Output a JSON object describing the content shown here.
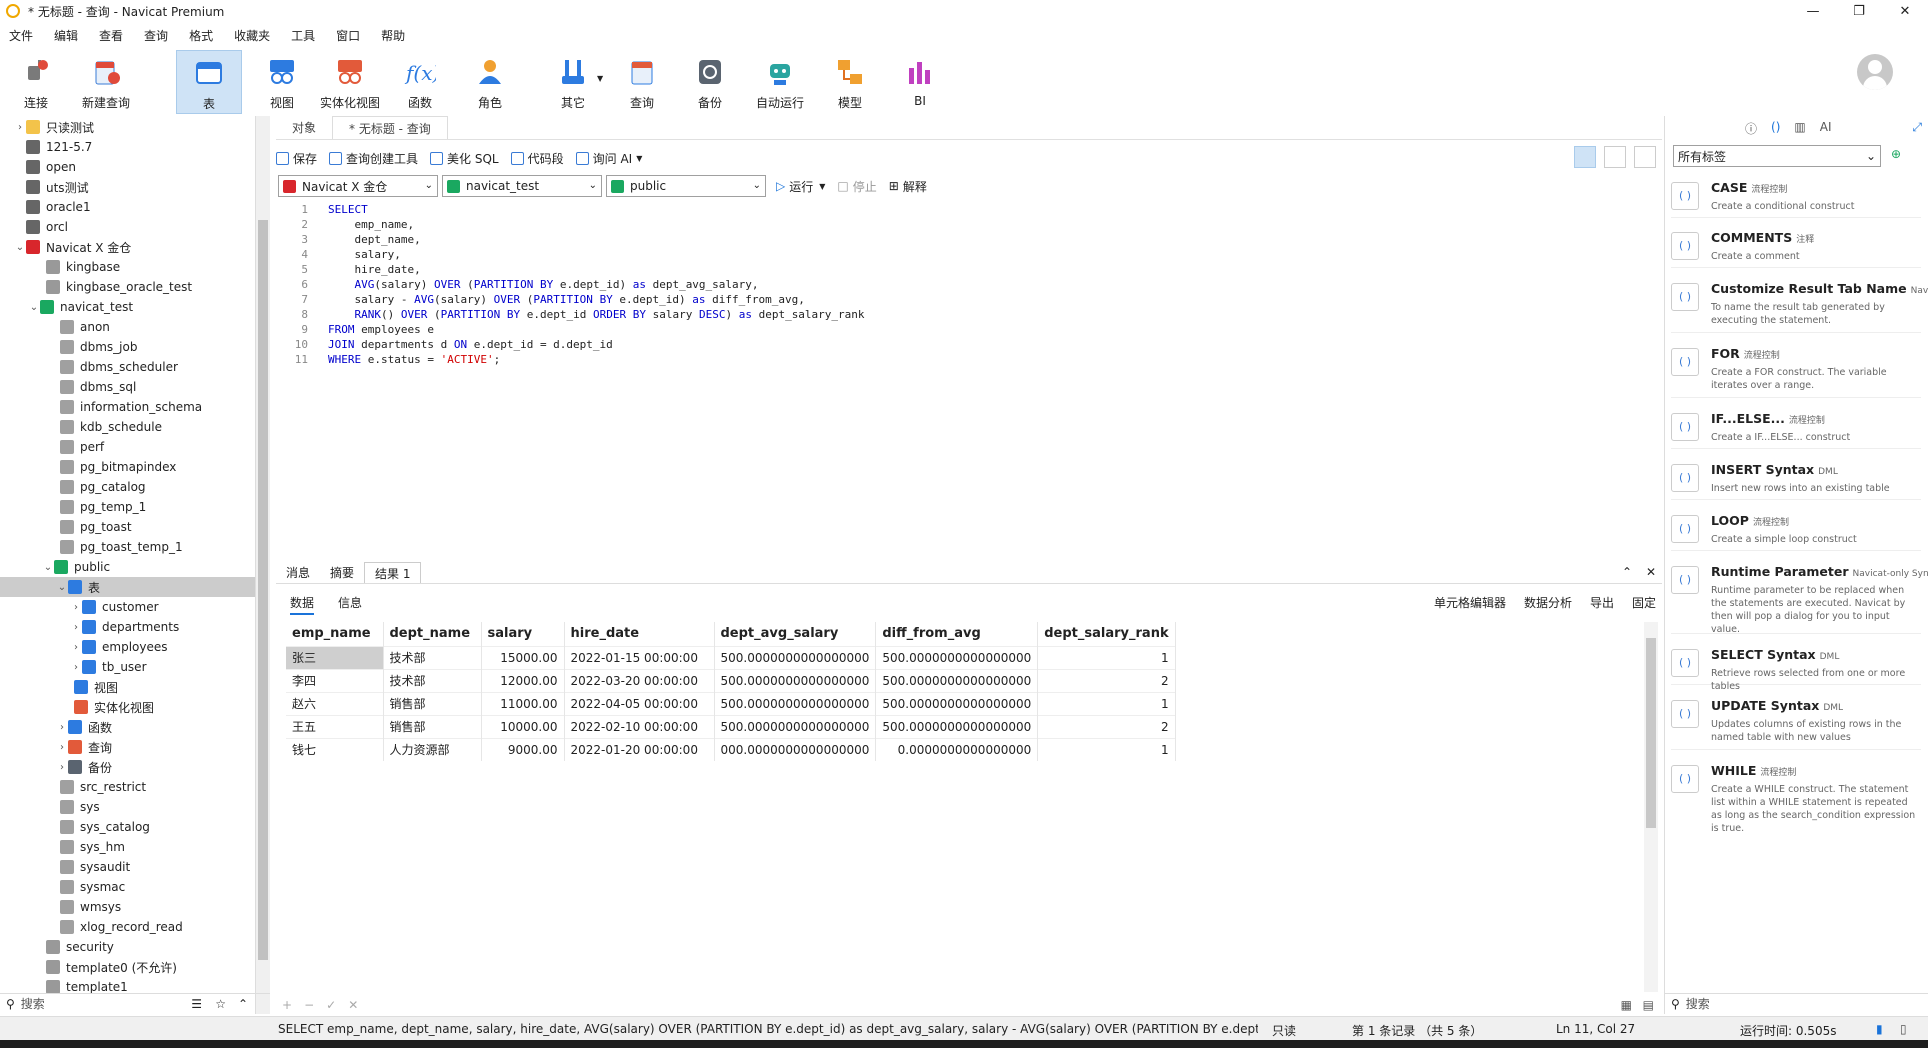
{
  "window": {
    "title": "* 无标题 - 查询 - Navicat Premium"
  },
  "menu": [
    "文件",
    "编辑",
    "查看",
    "查询",
    "格式",
    "收藏夹",
    "工具",
    "窗口",
    "帮助"
  ],
  "toolbar": [
    "连接",
    "新建查询",
    "表",
    "视图",
    "实体化视图",
    "函数",
    "角色",
    "其它",
    "查询",
    "备份",
    "自动运行",
    "模型",
    "BI"
  ],
  "tree": [
    "只读测试",
    "121-5.7",
    "open",
    "uts测试",
    "oracle1",
    "orcl",
    "Navicat X 金仓",
    "kingbase",
    "kingbase_oracle_test",
    "navicat_test",
    "anon",
    "dbms_job",
    "dbms_scheduler",
    "dbms_sql",
    "information_schema",
    "kdb_schedule",
    "perf",
    "pg_bitmapindex",
    "pg_catalog",
    "pg_temp_1",
    "pg_toast",
    "pg_toast_temp_1",
    "public",
    "表",
    "customer",
    "departments",
    "employees",
    "tb_user",
    "视图",
    "实体化视图",
    "函数",
    "查询",
    "备份",
    "src_restrict",
    "sys",
    "sys_catalog",
    "sys_hm",
    "sysaudit",
    "sysmac",
    "wmsys",
    "xlog_record_read",
    "security",
    "template0 (不允许)",
    "template1"
  ],
  "left_search": "搜索",
  "tabs": {
    "objects": "对象",
    "query": "* 无标题 - 查询"
  },
  "query_toolbar": {
    "save": "保存",
    "builder": "查询创建工具",
    "beautify": "美化 SQL",
    "snippet": "代码段",
    "ai": "询问 AI"
  },
  "selectors": {
    "connection": "Navicat X 金仓",
    "database": "navicat_test",
    "schema": "public",
    "run": "运行",
    "stop": "停止",
    "explain": "解释"
  },
  "code": [
    "SELECT",
    "    emp_name,",
    "    dept_name,",
    "    salary,",
    "    hire_date,",
    "    AVG(salary) OVER (PARTITION BY e.dept_id) as dept_avg_salary,",
    "    salary - AVG(salary) OVER (PARTITION BY e.dept_id) as diff_from_avg,",
    "    RANK() OVER (PARTITION BY e.dept_id ORDER BY salary DESC) as dept_salary_rank",
    "FROM employees e",
    "JOIN departments d ON e.dept_id = d.dept_id",
    "WHERE e.status = 'ACTIVE';"
  ],
  "result_tabs": [
    "消息",
    "摘要",
    "结果 1"
  ],
  "sub_tabs": [
    "数据",
    "信息"
  ],
  "result_actions": [
    "单元格编辑器",
    "数据分析",
    "导出",
    "固定"
  ],
  "columns": [
    "emp_name",
    "dept_name",
    "salary",
    "hire_date",
    "dept_avg_salary",
    "diff_from_avg",
    "dept_salary_rank"
  ],
  "rows": [
    [
      "张三",
      "技术部",
      "15000.00",
      "2022-01-15 00:00:00",
      "500.0000000000000000",
      "500.0000000000000000",
      "1"
    ],
    [
      "李四",
      "技术部",
      "12000.00",
      "2022-03-20 00:00:00",
      "500.0000000000000000",
      "500.0000000000000000",
      "2"
    ],
    [
      "赵六",
      "销售部",
      "11000.00",
      "2022-04-05 00:00:00",
      "500.0000000000000000",
      "500.0000000000000000",
      "1"
    ],
    [
      "王五",
      "销售部",
      "10000.00",
      "2022-02-10 00:00:00",
      "500.0000000000000000",
      "500.0000000000000000",
      "2"
    ],
    [
      "钱七",
      "人力资源部",
      "9000.00",
      "2022-01-20 00:00:00",
      "000.0000000000000000",
      "0.0000000000000000",
      "1"
    ]
  ],
  "right": {
    "tag_select": "所有标签",
    "search": "搜索",
    "snippets": [
      {
        "title": "CASE",
        "tag": "流程控制",
        "desc": "Create a conditional construct"
      },
      {
        "title": "COMMENTS",
        "tag": "注释",
        "desc": "Create a comment"
      },
      {
        "title": "Customize Result Tab Name",
        "tag": "Nav",
        "desc": "To name the result tab generated by executing the statement."
      },
      {
        "title": "FOR",
        "tag": "流程控制",
        "desc": "Create a FOR construct. The variable iterates over a range."
      },
      {
        "title": "IF...ELSE...",
        "tag": "流程控制",
        "desc": "Create a IF...ELSE... construct"
      },
      {
        "title": "INSERT Syntax",
        "tag": "DML",
        "desc": "Insert new rows into an existing table"
      },
      {
        "title": "LOOP",
        "tag": "流程控制",
        "desc": "Create a simple loop construct"
      },
      {
        "title": "Runtime Parameter",
        "tag": "Navicat-only Synt",
        "desc": "Runtime parameter to be replaced when the statements are executed. Navicat by then will pop a dialog for you to input value."
      },
      {
        "title": "SELECT Syntax",
        "tag": "DML",
        "desc": "Retrieve rows selected from one or more tables"
      },
      {
        "title": "UPDATE Syntax",
        "tag": "DML",
        "desc": "Updates columns of existing rows in the named table with new values"
      },
      {
        "title": "WHILE",
        "tag": "流程控制",
        "desc": "Create a WHILE construct. The statement list within a WHILE statement is repeated as long as the search_condition expression is true."
      }
    ]
  },
  "status": {
    "sql": "SELECT emp_name, dept_name, salary, hire_date, AVG(salary) OVER (PARTITION BY e.dept_id) as dept_avg_salary, salary - AVG(salary) OVER (PARTITION BY e.dept_id)",
    "readonly": "只读",
    "records": "第 1 条记录 （共 5 条）",
    "cursor": "Ln 11, Col 27",
    "time": "运行时间: 0.505s"
  },
  "colors": {
    "accent": "#1a73d9",
    "selected_tool": "#cfe3f6"
  }
}
